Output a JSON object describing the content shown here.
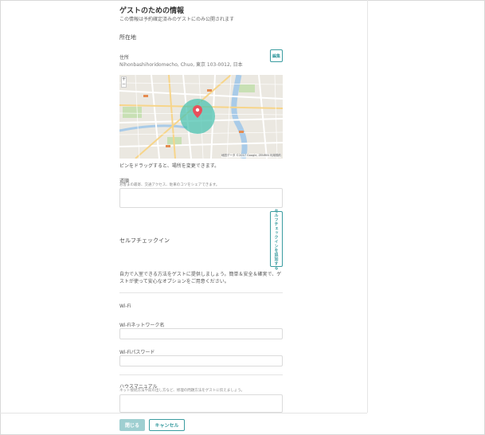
{
  "header": {
    "title": "ゲストのための情報",
    "subtitle": "この情報は予約確定済みのゲストにのみ公開されます"
  },
  "location": {
    "section_title": "所在地",
    "address_label": "住所",
    "address_value": "Nihonbashihoridomecho, Chuo, 東京 103-0012, 日本",
    "edit_label": "編集",
    "map_zoom_in": "+",
    "map_zoom_out": "−",
    "map_attribution": "地図データ ©2017 Google, ZENRIN   利用規約",
    "pin_hint": "ピンをドラッグすると、場所を変更できます。"
  },
  "directions": {
    "label": "道順",
    "help": "お客まの最寄、交通アクセス、駐車のコツをシェアできます。",
    "value": ""
  },
  "self_checkin": {
    "title": "セルフチェックイン",
    "button_label": "セルフチェックインを追加する",
    "description": "自力で入室できる方法をゲストに提供しましょう。簡単＆安全＆確実で、ゲストが使って安心なオプションをご用意ください。"
  },
  "wifi": {
    "section_title": "Wi-Fi",
    "network_label": "Wi-Fiネットワーク名",
    "network_value": "",
    "password_label": "Wi-Fiパスワード",
    "password_value": ""
  },
  "house_manual": {
    "label": "ハウスマニュアル",
    "help": "ネット接続方法や前の出し方など、修理の問題方法をゲストに伝えましょう。",
    "value": ""
  },
  "footer": {
    "close_label": "閉じる",
    "cancel_label": "キャンセル"
  },
  "colors": {
    "accent": "#3a9ca0",
    "accent_disabled": "#9fcfd1",
    "map_circle": "#4cc3b0",
    "map_pin": "#e8505b"
  }
}
